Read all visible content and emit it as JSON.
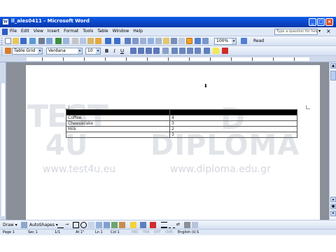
{
  "window": {
    "title": "ll_ales0411 - Microsoft Word",
    "app_icon": "W"
  },
  "menu": {
    "items": [
      "File",
      "Edit",
      "View",
      "Insert",
      "Format",
      "Tools",
      "Table",
      "Window",
      "Help"
    ],
    "help_placeholder": "Type a question for help",
    "help_arrow": "▾",
    "close_glyph": "×"
  },
  "toolbar": {
    "zoom": "100%",
    "read_label": "Read",
    "style_value": "Table Grid",
    "font_value": "Verdana",
    "size_value": "10",
    "bold": "B",
    "italic": "I",
    "underline": "U"
  },
  "document": {
    "table": {
      "rows": [
        {
          "c1": "",
          "c2": "",
          "selected": true
        },
        {
          "c1": "Coffee",
          "c2": "4"
        },
        {
          "c1": "Cheesecake",
          "c2": "3"
        },
        {
          "c1": "Milk",
          "c2": "2"
        },
        {
          "c1": "",
          "c2": "3"
        }
      ]
    },
    "watermark": {
      "brand_main": "TEST",
      "brand_sub": "4U",
      "url_left": "www.test4u.eu",
      "diploma": "DIPLOMA",
      "url_right": "www.diploma.edu.gr"
    }
  },
  "drawing_toolbar": {
    "draw": "Draw ▾",
    "autoshapes": "AutoShapes ▾"
  },
  "status": {
    "page": "Page 1",
    "sec": "Sec 1",
    "pages": "1/1",
    "at": "At 1\"",
    "ln": "Ln 1",
    "col": "Col 1",
    "rec": "REC",
    "trk": "TRK",
    "ext": "EXT",
    "ovr": "OVR",
    "lang": "English (U.S"
  },
  "colors": {
    "title_bar": "#0a46c8",
    "menu_bg": "#dfe8f6",
    "doc_bg": "#8a8f98",
    "selection": "#000000"
  },
  "icons": [
    "new-icon",
    "open-icon",
    "save-icon",
    "print-icon",
    "undo-icon",
    "redo-icon",
    "table-icon",
    "close-icon",
    "scroll-up-icon",
    "scroll-down-icon"
  ]
}
